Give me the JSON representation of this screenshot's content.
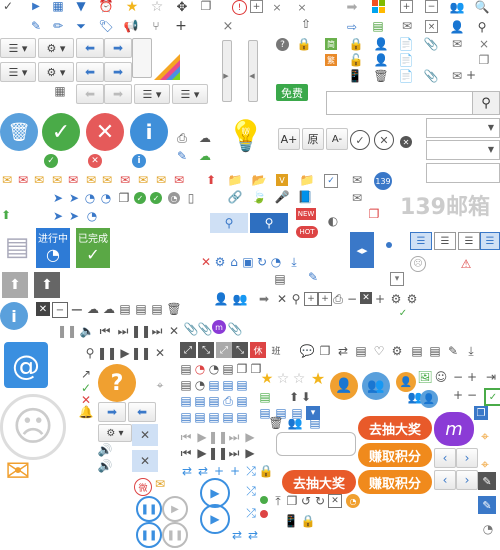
{
  "labels": {
    "free_badge": "免费",
    "original": "原",
    "in_progress": "进行中",
    "completed": "已完成",
    "brand": "139邮箱",
    "new_tag": "NEW",
    "hot_tag": "HOT",
    "draw_prize_1": "去抽大奖",
    "draw_prize_2": "去抽大奖",
    "earn_points_1": "赚取积分",
    "earn_points_2": "赚取积分",
    "rest_tag": "休",
    "class_tag": "班",
    "number_139": "139",
    "font_size_up": "A+",
    "font_size_down": "A-"
  },
  "search": {
    "placeholder": ""
  },
  "colors": {
    "blue": "#2e8ae6",
    "green": "#5ab04a",
    "red": "#e0504c",
    "orange": "#f08a1c",
    "pill_orange": "#ef6b2b",
    "purple": "#8b3bd6"
  },
  "icons": [
    "check-icon",
    "gear-icon",
    "edit-icon",
    "tag-icon",
    "alarm-icon",
    "star-icon",
    "star-outline-icon",
    "move-icon",
    "copy-icon",
    "alert-icon",
    "plus-icon",
    "question-icon",
    "lock-icon",
    "user-icon",
    "document-icon",
    "paperclip-icon",
    "mail-icon",
    "search-icon",
    "trash-icon",
    "close-icon",
    "info-icon",
    "lightbulb-icon",
    "home-icon",
    "refresh-icon",
    "download-icon",
    "print-icon",
    "sad-face-icon",
    "at-icon",
    "weibo-icon",
    "play-icon",
    "pause-icon",
    "smile-icon"
  ]
}
